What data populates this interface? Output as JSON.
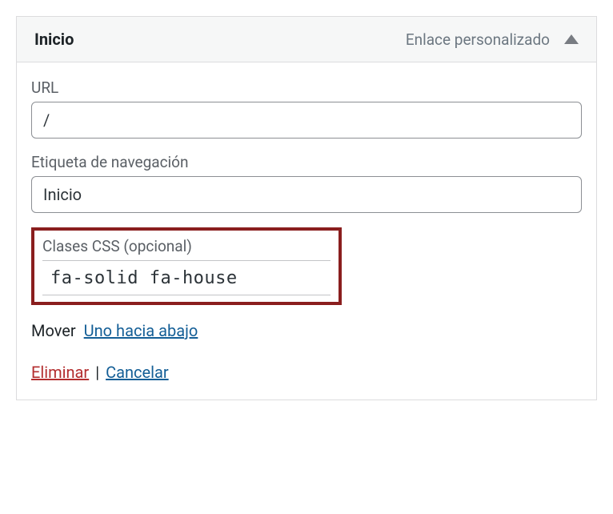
{
  "header": {
    "title": "Inicio",
    "type": "Enlace personalizado"
  },
  "fields": {
    "url": {
      "label": "URL",
      "value": "/"
    },
    "nav_label": {
      "label": "Etiqueta de navegación",
      "value": "Inicio"
    },
    "css_classes": {
      "label": "Clases CSS (opcional)",
      "value": "fa-solid fa-house"
    }
  },
  "move": {
    "label": "Mover",
    "down": "Uno hacia abajo"
  },
  "actions": {
    "delete": "Eliminar",
    "separator": "|",
    "cancel": "Cancelar"
  }
}
